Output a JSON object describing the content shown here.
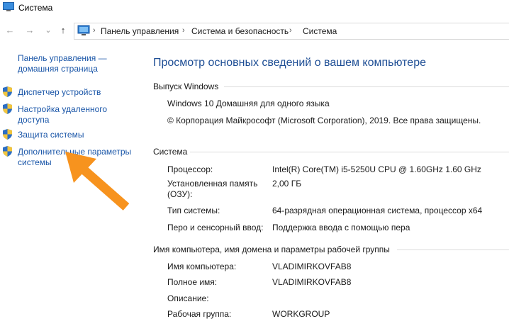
{
  "window": {
    "title": "Система"
  },
  "nav": {
    "back": "←",
    "forward": "→",
    "dropdown": "⌄",
    "up": "↑"
  },
  "breadcrumb": [
    "Панель управления",
    "Система и безопасность",
    "Система"
  ],
  "breadcrumb_sep": "›",
  "sidebar": {
    "home_label_1": "Панель управления —",
    "home_label_2": "домашняя страница",
    "items": [
      {
        "label_1": "Диспетчер устройств",
        "label_2": ""
      },
      {
        "label_1": "Настройка удаленного",
        "label_2": "доступа"
      },
      {
        "label_1": "Защита системы",
        "label_2": ""
      },
      {
        "label_1": "Дополнительные параметры",
        "label_2": "системы"
      }
    ]
  },
  "main": {
    "heading": "Просмотр основных сведений о вашем компьютере",
    "edition": {
      "title": "Выпуск Windows",
      "lines": [
        "Windows 10 Домашняя для одного языка",
        "© Корпорация Майкрософт (Microsoft Corporation), 2019. Все права защищены."
      ]
    },
    "system": {
      "title": "Система",
      "rows": [
        {
          "label_1": "Процессор:",
          "label_2": "",
          "value": "Intel(R) Core(TM) i5-5250U CPU @ 1.60GHz   1.60 GHz"
        },
        {
          "label_1": "Установленная память",
          "label_2": "(ОЗУ):",
          "value": "2,00 ГБ"
        },
        {
          "label_1": "Тип системы:",
          "label_2": "",
          "value": "64-разрядная операционная система, процессор x64"
        },
        {
          "label_1": "Перо и сенсорный ввод:",
          "label_2": "",
          "value": "Поддержка ввода с помощью пера"
        }
      ]
    },
    "computer": {
      "title": "Имя компьютера, имя домена и параметры рабочей группы",
      "rows": [
        {
          "label": "Имя компьютера:",
          "value": "VLADIMIRKOVFAB8"
        },
        {
          "label": "Полное имя:",
          "value": "VLADIMIRKOVFAB8"
        },
        {
          "label": "Описание:",
          "value": ""
        },
        {
          "label": "Рабочая группа:",
          "value": "WORKGROUP"
        }
      ]
    }
  },
  "colors": {
    "link": "#1a56a8",
    "heading": "#1e4e95",
    "arrow": "#f7931e"
  }
}
